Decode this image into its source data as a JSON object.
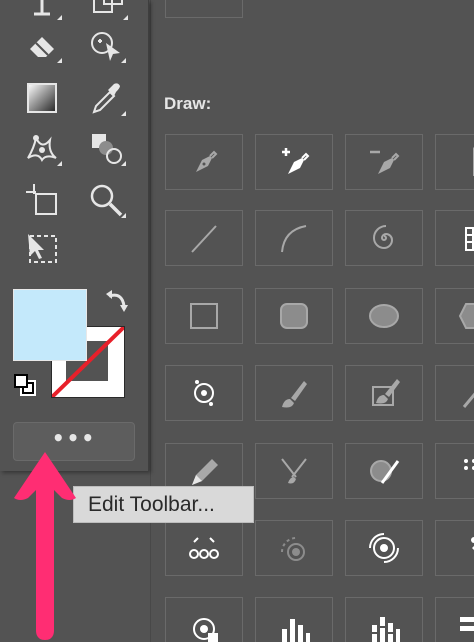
{
  "colors": {
    "background": "#535353",
    "fill_color": "#c4e9fb",
    "stroke_none_slash": "#e8202a",
    "arrow": "#ff2d73",
    "icon": "#e6e6e6",
    "panel_icon": "#a8a8a8"
  },
  "toolbar": {
    "tools": [
      {
        "name": "type-tool",
        "icon": "type-icon"
      },
      {
        "name": "shape-tool",
        "icon": "shape-icon"
      },
      {
        "name": "eraser-tool",
        "icon": "eraser-icon"
      },
      {
        "name": "shape-builder-tool",
        "icon": "shape-builder-icon"
      },
      {
        "name": "gradient-tool",
        "icon": "gradient-icon"
      },
      {
        "name": "eyedropper-tool",
        "icon": "eyedropper-icon"
      },
      {
        "name": "puppet-warp-tool",
        "icon": "puppet-warp-icon"
      },
      {
        "name": "blend-tool",
        "icon": "blend-icon"
      },
      {
        "name": "artboard-tool",
        "icon": "artboard-icon"
      },
      {
        "name": "zoom-tool",
        "icon": "zoom-icon"
      },
      {
        "name": "perspective-selection-tool",
        "icon": "perspective-selection-icon"
      }
    ],
    "edit_toolbar_label": "•••"
  },
  "tooltip": {
    "text": "Edit Toolbar..."
  },
  "panel": {
    "section_label": "Draw:",
    "rows": [
      [
        "pen-icon",
        "add-anchor-point-icon",
        "delete-anchor-point-icon",
        "anchor-point-icon"
      ],
      [
        "line-segment-icon",
        "arc-icon",
        "spiral-icon",
        "rectangular-grid-icon"
      ],
      [
        "rectangle-icon",
        "rounded-rectangle-icon",
        "ellipse-icon",
        "polygon-icon"
      ],
      [
        "star-flare-icon",
        "paintbrush-icon",
        "blob-brush-icon",
        "flare-icon"
      ],
      [
        "pencil-icon",
        "scissors-smooth-icon",
        "shaper-icon",
        "symbol-sprayer-icon"
      ],
      [
        "symbol-shifter-icon",
        "symbol-scruncher-icon",
        "symbol-spinner-icon",
        "symbol-stainer-icon"
      ],
      [
        "symbol-screener-icon",
        "column-graph-icon",
        "stacked-column-graph-icon",
        "bar-graph-icon"
      ]
    ]
  }
}
